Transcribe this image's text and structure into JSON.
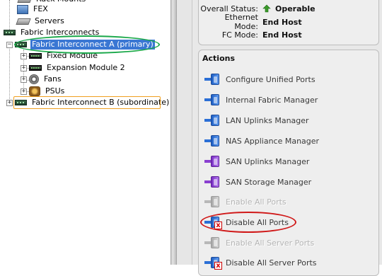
{
  "tree": {
    "items": [
      {
        "label": "FEX",
        "icon": "fex-icon"
      },
      {
        "label": "Servers",
        "icon": "server-icon"
      },
      {
        "label": "Fabric Interconnects",
        "icon": "chassis-icon"
      },
      {
        "label": "Fabric Interconnect A (primary)",
        "icon": "chassis-icon",
        "expander": "−",
        "selected": true
      },
      {
        "label": "Fixed Module",
        "icon": "module-icon",
        "expander": "+"
      },
      {
        "label": "Expansion Module 2",
        "icon": "module-icon",
        "expander": "+"
      },
      {
        "label": "Fans",
        "icon": "fan-icon",
        "expander": "+"
      },
      {
        "label": "PSUs",
        "icon": "psu-icon",
        "expander": "+"
      },
      {
        "label": "Fabric Interconnect B (subordinate)",
        "icon": "chassis-icon",
        "expander": "+"
      }
    ]
  },
  "status": {
    "overall_label": "Overall Status:",
    "overall_value": "Operable",
    "ethernet_label": "Ethernet Mode:",
    "ethernet_value": "End Host",
    "fc_label": "FC Mode:",
    "fc_value": "End Host"
  },
  "actions": {
    "title": "Actions",
    "items": [
      {
        "label": "Configure Unified Ports",
        "color": "blue",
        "enabled": true
      },
      {
        "label": "Internal Fabric Manager",
        "color": "blue",
        "enabled": true
      },
      {
        "label": "LAN Uplinks Manager",
        "color": "blue",
        "enabled": true
      },
      {
        "label": "NAS Appliance Manager",
        "color": "blue",
        "enabled": true
      },
      {
        "label": "SAN Uplinks Manager",
        "color": "purple",
        "enabled": true
      },
      {
        "label": "SAN Storage Manager",
        "color": "purple",
        "enabled": true
      },
      {
        "label": "Enable All Ports",
        "color": "grey",
        "enabled": false
      },
      {
        "label": "Disable All Ports",
        "color": "blue",
        "enabled": true,
        "badge": "x"
      },
      {
        "label": "Enable All Server Ports",
        "color": "grey",
        "enabled": false
      },
      {
        "label": "Disable All Server Ports",
        "color": "blue",
        "enabled": true,
        "badge": "x"
      }
    ]
  },
  "colors": {
    "selection": "#3a77d3",
    "highlight_green": "#1aa84a",
    "highlight_orange": "#f0a020",
    "highlight_red": "#d01818",
    "status_ok": "#3a9a2a"
  }
}
